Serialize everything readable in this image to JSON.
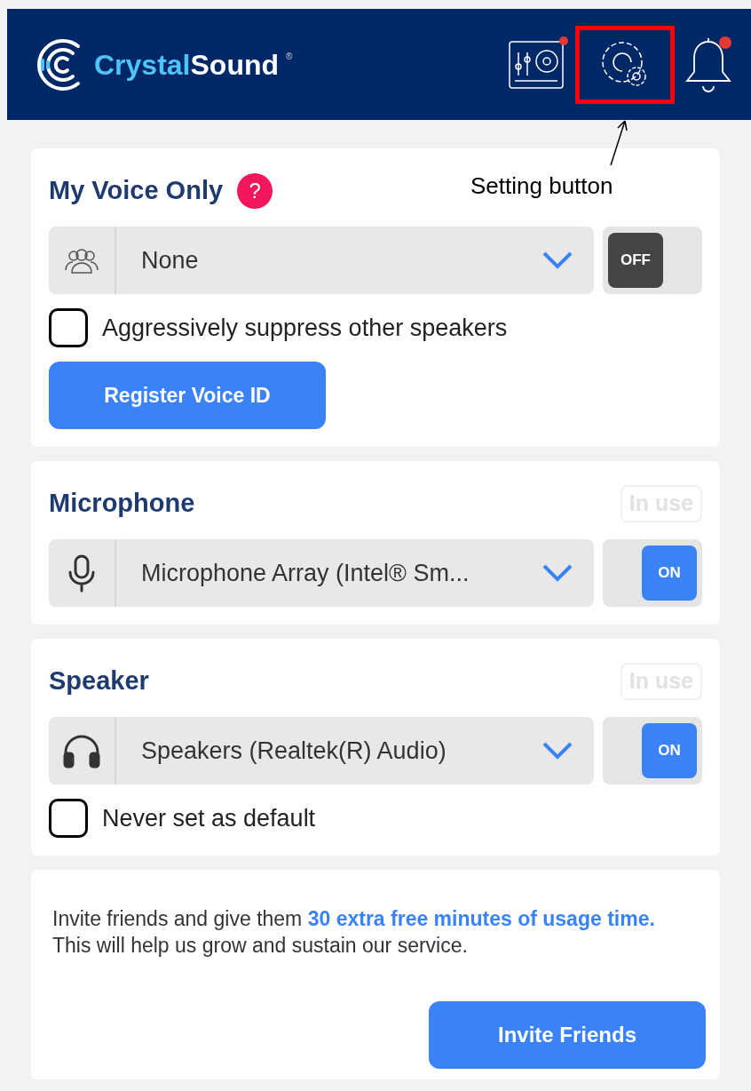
{
  "header": {
    "logo_part_1": "Crystal",
    "logo_part_2": "Sound",
    "logo_mark": "®",
    "mixer_badge": true,
    "bell_badge": true,
    "settings_highlighted": true
  },
  "annotation": {
    "label": "Setting button"
  },
  "sections": [
    {
      "kind": "voice",
      "title": "My Voice Only",
      "help": "?",
      "value": "None",
      "toggle": {
        "on": false,
        "label": "OFF"
      },
      "checkbox": {
        "label": "Aggressively suppress other speakers",
        "checked": false
      },
      "button": "Register Voice ID"
    },
    {
      "kind": "microphone",
      "title": "Microphone",
      "status": "In use",
      "value": "Microphone Array (Intel® Sm...",
      "toggle": {
        "on": true,
        "label": "ON"
      }
    },
    {
      "kind": "speaker",
      "title": "Speaker",
      "status": "In use",
      "value": "Speakers (Realtek(R) Audio)",
      "toggle": {
        "on": true,
        "label": "ON"
      },
      "checkbox": {
        "label": "Never set as default",
        "checked": false
      }
    }
  ],
  "invite": {
    "text": "Invite friends and give them **30 extra free minutes of usage time.** This will help us grow and sustain our service.",
    "button": "Invite Friends"
  }
}
